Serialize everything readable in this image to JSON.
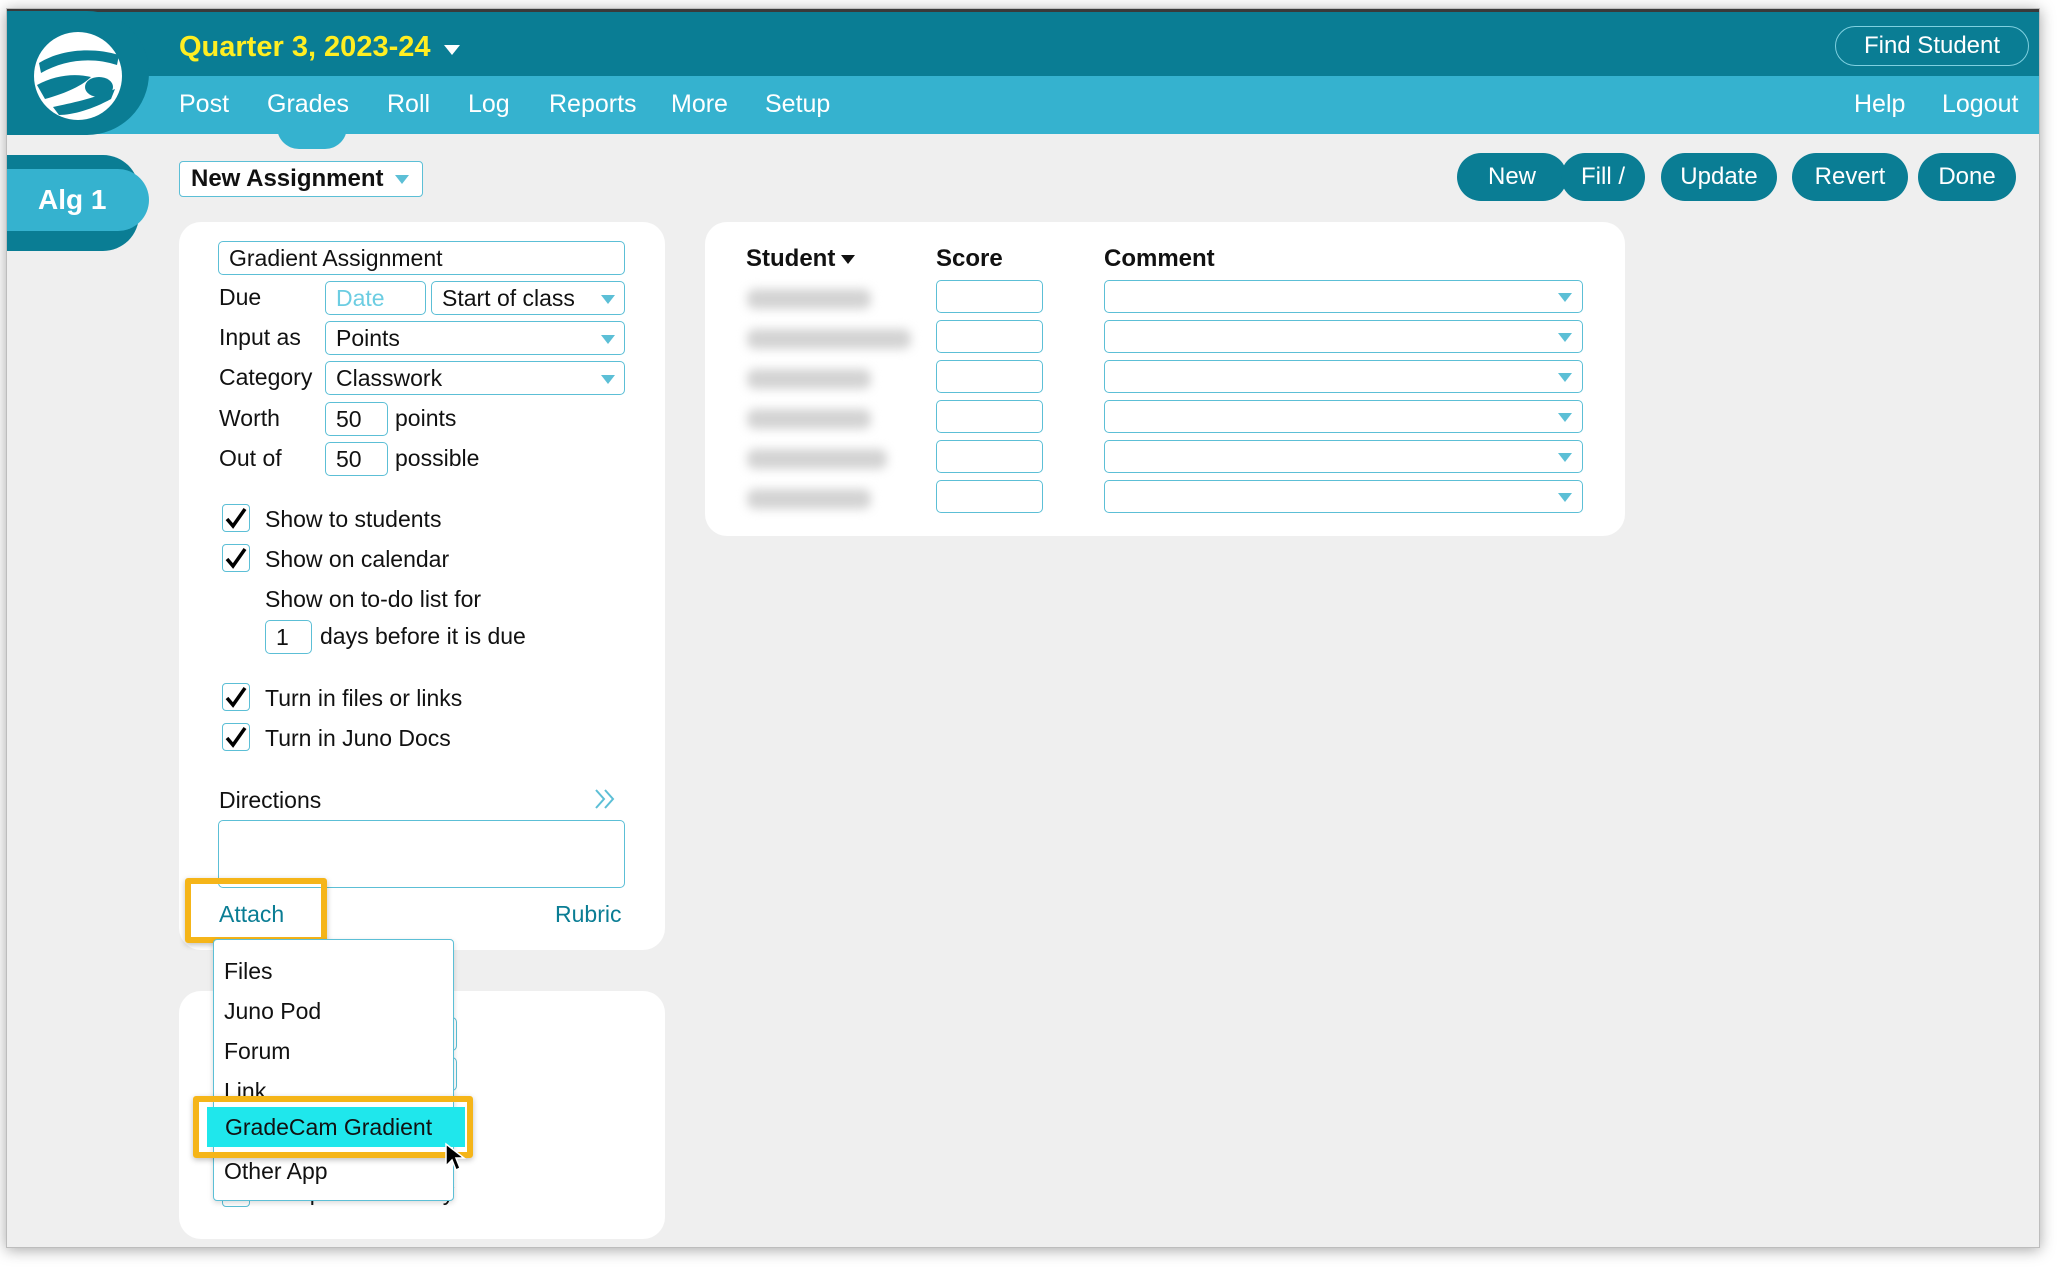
{
  "header": {
    "term": "Quarter 3, 2023-24",
    "find_student": "Find Student"
  },
  "nav": {
    "items": [
      "Post",
      "Grades",
      "Roll",
      "Log",
      "Reports",
      "More",
      "Setup"
    ],
    "help": "Help",
    "logout": "Logout"
  },
  "class_tab": "Alg 1",
  "assignment_select": "New Assignment",
  "actions": [
    "New",
    "Fill /",
    "Update",
    "Revert",
    "Done"
  ],
  "form": {
    "title_value": "Gradient Assignment",
    "due_label": "Due",
    "date_placeholder": "Date",
    "due_time": "Start of class",
    "input_as_label": "Input as",
    "input_as_value": "Points",
    "category_label": "Category",
    "category_value": "Classwork",
    "worth_label": "Worth",
    "worth_value": "50",
    "worth_unit": "points",
    "out_of_label": "Out of",
    "out_of_value": "50",
    "out_of_unit": "possible",
    "show_students": "Show to students",
    "show_calendar": "Show on calendar",
    "todo_label": "Show on to-do list for",
    "todo_days": "1",
    "todo_suffix": "days before it is due",
    "turn_in_files": "Turn in files or links",
    "turn_in_docs": "Turn in Juno Docs",
    "directions_label": "Directions",
    "attach": "Attach",
    "rubric": "Rubric"
  },
  "attach_menu": {
    "items": [
      "Files",
      "Juno Pod",
      "Forum",
      "Link",
      "GradeCam Gradient",
      "Other App"
    ],
    "active": "GradeCam Gradient",
    "hidden_behind": "Independent study"
  },
  "grid": {
    "student_header": "Student",
    "score_header": "Score",
    "comment_header": "Comment",
    "row_count": 6
  },
  "colors": {
    "header_dark": "#0a7d94",
    "header_light": "#35b2cf",
    "term_yellow": "#ffee22",
    "highlight": "#f5b519",
    "menu_active": "#1fe7ec"
  }
}
